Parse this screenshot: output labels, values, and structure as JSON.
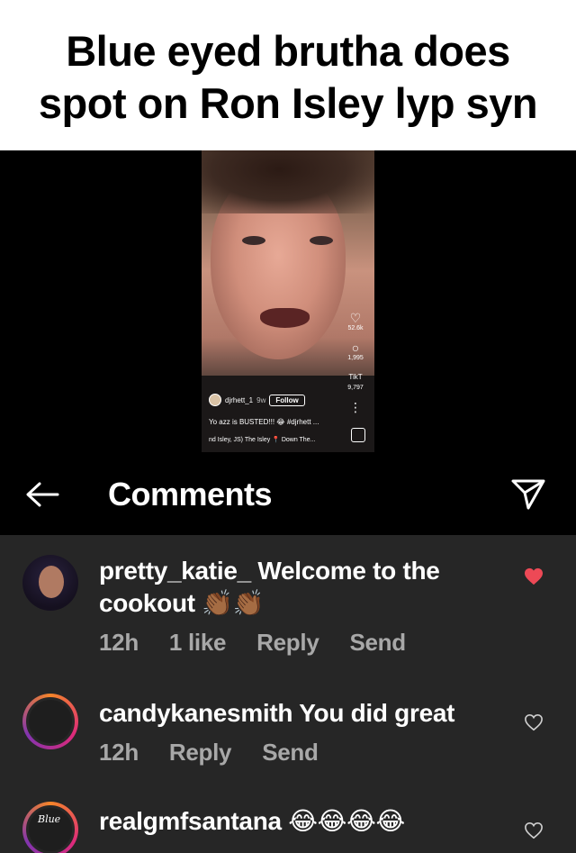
{
  "meme": {
    "title_line1": "Blue eyed brutha does",
    "title_line2": "spot on Ron Isley lyp syn"
  },
  "video": {
    "username": "djrhett_1",
    "posted": "9w",
    "follow_label": "Follow",
    "caption": "Yo azz is BUSTED!!! 😂 #djrhett ...",
    "music": "nd Isley, JS)  The Isley  📍 Down The...",
    "likes": "52.6k",
    "comments_count": "1,995",
    "shares": "9,797",
    "more_dots": "⋮",
    "tiktok_mark": "TikT"
  },
  "header": {
    "title": "Comments",
    "back_icon": "arrow-left-icon",
    "send_icon": "paper-plane-icon"
  },
  "comments": [
    {
      "username": "pretty_katie_",
      "text_a": "Welcome to the",
      "text_b": "cookout",
      "emoji": "👏🏾👏🏾",
      "time": "12h",
      "likes": "1 like",
      "reply": "Reply",
      "send": "Send",
      "liked": true
    },
    {
      "username": "candykanesmith",
      "text": "You did great",
      "time": "12h",
      "reply": "Reply",
      "send": "Send",
      "liked": false
    },
    {
      "username": "realgmfsantana",
      "emoji": "😂😂😂😂",
      "avatar_text": "Blue",
      "liked": false
    }
  ],
  "colors": {
    "liked_heart": "#ed4956",
    "comments_bg": "#262626",
    "meta_text": "#a8a8a8"
  }
}
